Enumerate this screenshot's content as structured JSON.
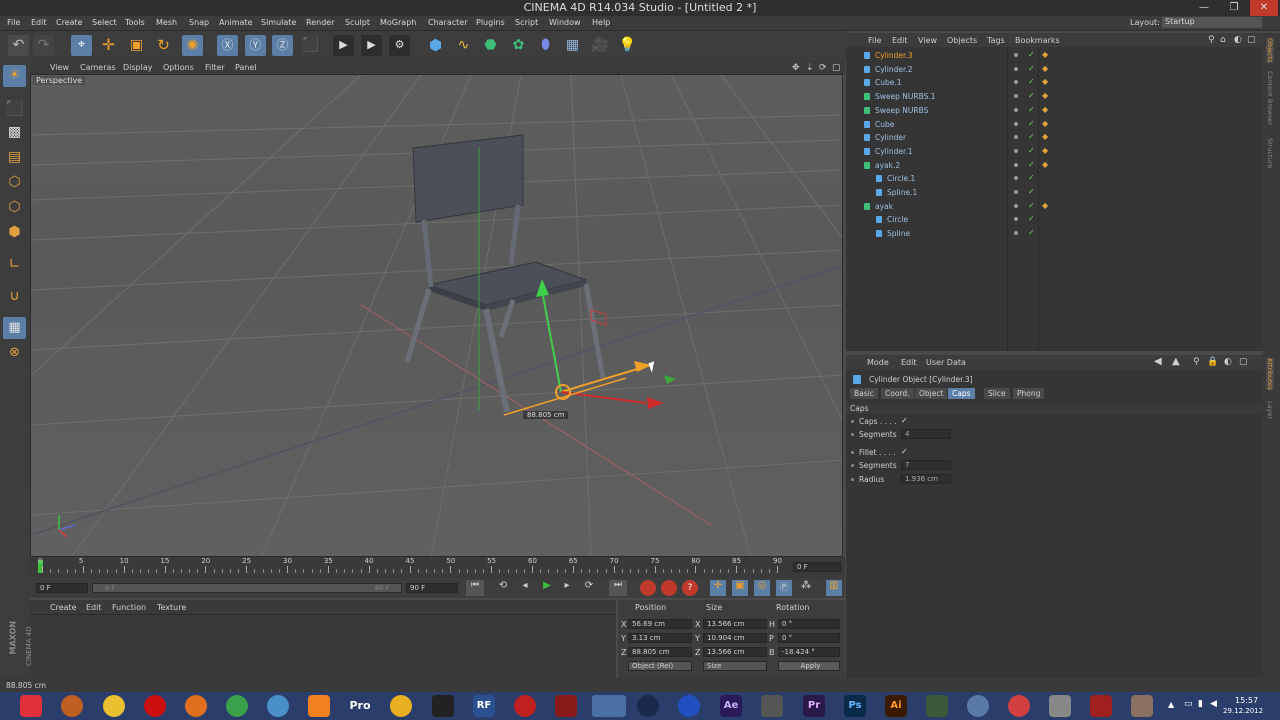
{
  "app": {
    "title": "CINEMA 4D R14.034 Studio - [Untitled 2 *]",
    "layout_label": "Layout:",
    "layout_value": "Startup"
  },
  "menu": [
    "File",
    "Edit",
    "Create",
    "Select",
    "Tools",
    "Mesh",
    "Snap",
    "Animate",
    "Simulate",
    "Render",
    "Sculpt",
    "MoGraph",
    "Character",
    "Plugins",
    "Script",
    "Window",
    "Help"
  ],
  "viewport": {
    "menu": [
      "View",
      "Cameras",
      "Display",
      "Options",
      "Filter",
      "Panel"
    ],
    "label": "Perspective",
    "hud_value": "88.805 cm"
  },
  "timeline": {
    "ticks": [
      "0",
      "5",
      "10",
      "15",
      "20",
      "25",
      "30",
      "35",
      "40",
      "45",
      "50",
      "55",
      "60",
      "65",
      "70",
      "75",
      "80",
      "85",
      "90"
    ],
    "frame_readout": "0 F",
    "start": "0 F",
    "slider_start": "0 F",
    "slider_end": "90 F",
    "end": "90 F"
  },
  "material_menu": [
    "Create",
    "Edit",
    "Function",
    "Texture"
  ],
  "brand": {
    "maxon": "MAXON",
    "c4d": "CINEMA 4D"
  },
  "coords": {
    "headers": [
      "Position",
      "Size",
      "Rotation"
    ],
    "rows": [
      {
        "axis": "X",
        "pos": "56.69 cm",
        "size_axis": "X",
        "size": "13.566 cm",
        "rot_axis": "H",
        "rot": "0 °"
      },
      {
        "axis": "Y",
        "pos": "3.13 cm",
        "size_axis": "Y",
        "size": "10.904 cm",
        "rot_axis": "P",
        "rot": "0 °"
      },
      {
        "axis": "Z",
        "pos": "88.805 cm",
        "size_axis": "Z",
        "size": "13.566 cm",
        "rot_axis": "B",
        "rot": "-18.424 °"
      }
    ],
    "mode": "Object (Rel)",
    "size_mode": "Size",
    "apply": "Apply"
  },
  "object_manager": {
    "menu": [
      "File",
      "Edit",
      "View",
      "Objects",
      "Tags",
      "Bookmarks"
    ],
    "objects": [
      {
        "name": "Cylinder.3",
        "indent": 0,
        "selected": true,
        "tag": true
      },
      {
        "name": "Cylinder.2",
        "indent": 0,
        "selected": false,
        "tag": true
      },
      {
        "name": "Cube.1",
        "indent": 0,
        "selected": false,
        "tag": true
      },
      {
        "name": "Sweep NURBS.1",
        "indent": 0,
        "selected": false,
        "tag": true
      },
      {
        "name": "Sweep NURBS",
        "indent": 0,
        "selected": false,
        "tag": true
      },
      {
        "name": "Cube",
        "indent": 0,
        "selected": false,
        "tag": true
      },
      {
        "name": "Cylinder",
        "indent": 0,
        "selected": false,
        "tag": true
      },
      {
        "name": "Cylinder.1",
        "indent": 0,
        "selected": false,
        "tag": true
      },
      {
        "name": "ayak.2",
        "indent": 0,
        "selected": false,
        "tag": true
      },
      {
        "name": "Circle.1",
        "indent": 1,
        "selected": false,
        "tag": false
      },
      {
        "name": "Spline.1",
        "indent": 1,
        "selected": false,
        "tag": false
      },
      {
        "name": "ayak",
        "indent": 0,
        "selected": false,
        "tag": true
      },
      {
        "name": "Circle",
        "indent": 1,
        "selected": false,
        "tag": false
      },
      {
        "name": "Spline",
        "indent": 1,
        "selected": false,
        "tag": false
      }
    ]
  },
  "attributes": {
    "menu": [
      "Mode",
      "Edit",
      "User Data"
    ],
    "object_title": "Cylinder Object [Cylinder.3]",
    "tabs": [
      "Basic",
      "Coord.",
      "Object",
      "Caps",
      "Slice",
      "Phong"
    ],
    "active_tab": "Caps",
    "section": "Caps",
    "rows": [
      {
        "label": "Caps . . . .",
        "value": "✓",
        "type": "check"
      },
      {
        "label": "Segments",
        "value": "4",
        "type": "field"
      },
      {
        "label": "Fillet . . . .",
        "value": "✓",
        "type": "check"
      },
      {
        "label": "Segments",
        "value": "7",
        "type": "field"
      },
      {
        "label": "Radius",
        "value": "1.936 cm",
        "type": "field"
      }
    ]
  },
  "right_tabs": [
    "Objects",
    "Content Browser",
    "Structure",
    "Attributes",
    "Layer"
  ],
  "status": "88.805 cm",
  "clock": {
    "time": "15:57",
    "date": "29.12.2012"
  },
  "taskbar_labels": {
    "pro": "Pro",
    "rf": "RF",
    "ae": "Ae",
    "pr": "Pr",
    "ps": "Ps",
    "ai": "Ai"
  }
}
